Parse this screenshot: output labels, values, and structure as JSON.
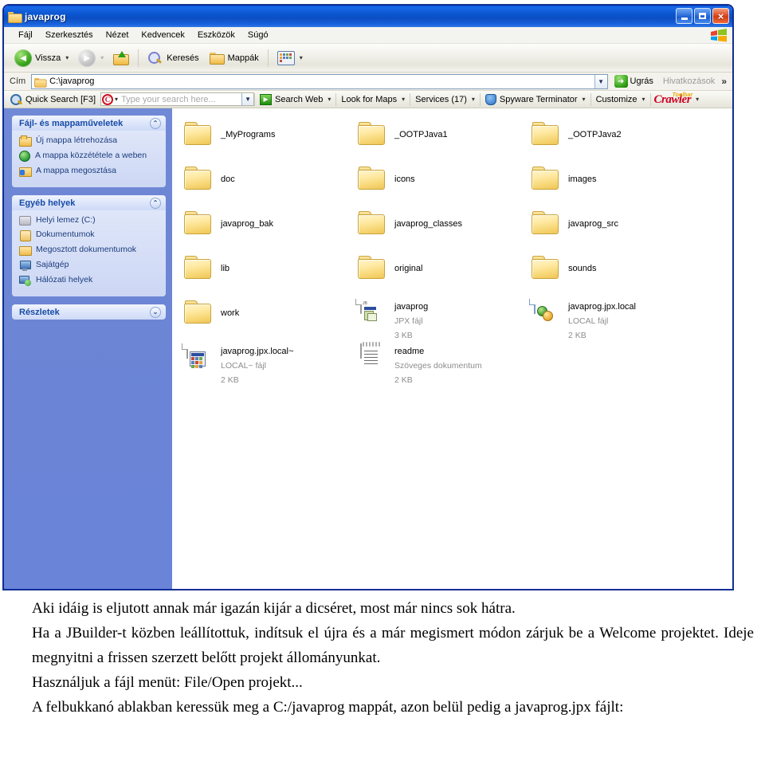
{
  "window": {
    "title": "javaprog",
    "buttons": {
      "minimize": "minimize-button",
      "maximize": "maximize-button",
      "close": "×"
    }
  },
  "menubar": {
    "items": [
      {
        "label": "Fájl",
        "accel": "F"
      },
      {
        "label": "Szerkesztés",
        "accel": "z"
      },
      {
        "label": "Nézet",
        "accel": "N"
      },
      {
        "label": "Kedvencek",
        "accel": "v"
      },
      {
        "label": "Eszközök",
        "accel": "E"
      },
      {
        "label": "Súgó",
        "accel": "S"
      }
    ]
  },
  "toolbar": {
    "back_label": "Vissza",
    "forward_label": "",
    "up_label": "",
    "search_label": "Keresés",
    "folders_label": "Mappák",
    "views_label": ""
  },
  "addressbar": {
    "label": "Cím",
    "value": "C:\\javaprog",
    "go_label": "Ugrás",
    "links_label": "Hivatkozások",
    "more_chevron": "»"
  },
  "crawlerbar": {
    "quick_search_label": "Quick Search [F3]",
    "search_placeholder": "Type your search here...",
    "search_value": "",
    "search_web_label": "Search Web",
    "look_for_maps_label": "Look for Maps",
    "services_label": "Services (17)",
    "spyware_label": "Spyware Terminator",
    "customize_label": "Customize",
    "brand_label": "Crawler",
    "brand_sup": "Toolbar",
    "caret": "▾"
  },
  "sidebar": {
    "panels": [
      {
        "title": "Fájl- és mappaműveletek",
        "chevron": "⌃",
        "collapsed": false,
        "items": [
          {
            "label": "Új mappa létrehozása",
            "icon": "new-folder-icon"
          },
          {
            "label": "A mappa közzététele a weben",
            "icon": "publish-web-icon"
          },
          {
            "label": "A mappa megosztása",
            "icon": "share-folder-icon"
          }
        ]
      },
      {
        "title": "Egyéb helyek",
        "chevron": "⌃",
        "collapsed": false,
        "items": [
          {
            "label": "Helyi lemez (C:)",
            "icon": "local-disk-icon"
          },
          {
            "label": "Dokumentumok",
            "icon": "documents-icon"
          },
          {
            "label": "Megosztott dokumentumok",
            "icon": "shared-documents-icon"
          },
          {
            "label": "Sajátgép",
            "icon": "my-computer-icon"
          },
          {
            "label": "Hálózati helyek",
            "icon": "network-places-icon"
          }
        ]
      },
      {
        "title": "Részletek",
        "chevron": "⌄",
        "collapsed": true,
        "items": []
      }
    ]
  },
  "files": [
    {
      "name": "_MyPrograms",
      "type": "folder",
      "subtype": "",
      "size": ""
    },
    {
      "name": "_OOTPJava1",
      "type": "folder",
      "subtype": "",
      "size": ""
    },
    {
      "name": "_OOTPJava2",
      "type": "folder",
      "subtype": "",
      "size": ""
    },
    {
      "name": "doc",
      "type": "folder",
      "subtype": "",
      "size": ""
    },
    {
      "name": "icons",
      "type": "folder",
      "subtype": "",
      "size": ""
    },
    {
      "name": "images",
      "type": "folder",
      "subtype": "",
      "size": ""
    },
    {
      "name": "javaprog_bak",
      "type": "folder",
      "subtype": "",
      "size": ""
    },
    {
      "name": "javaprog_classes",
      "type": "folder",
      "subtype": "",
      "size": ""
    },
    {
      "name": "javaprog_src",
      "type": "folder",
      "subtype": "",
      "size": ""
    },
    {
      "name": "lib",
      "type": "folder",
      "subtype": "",
      "size": ""
    },
    {
      "name": "original",
      "type": "folder",
      "subtype": "",
      "size": ""
    },
    {
      "name": "sounds",
      "type": "folder",
      "subtype": "",
      "size": ""
    },
    {
      "name": "work",
      "type": "folder",
      "subtype": "",
      "size": ""
    },
    {
      "name": "javaprog",
      "type": "jpx",
      "subtype": "JPX fájl",
      "size": "3 KB"
    },
    {
      "name": "javaprog.jpx.local",
      "type": "local",
      "subtype": "LOCAL fájl",
      "size": "2 KB"
    },
    {
      "name": "javaprog.jpx.local~",
      "type": "localtilde",
      "subtype": "LOCAL~ fájl",
      "size": "2 KB"
    },
    {
      "name": "readme",
      "type": "text",
      "subtype": "Szöveges dokumentum",
      "size": "2 KB"
    }
  ],
  "bodytext": {
    "line1": "Aki idáig is eljutott annak már igazán kijár a dicséret, most már nincs sok hátra.",
    "line2": "Ha a JBuilder-t közben leállítottuk, indítsuk el újra és a már megismert módon zárjuk be a Welcome projektet. Ideje megnyitni a frissen szerzett belőtt projekt állományunkat.",
    "line3": "Használjuk a fájl menüt: File/Open projekt...",
    "line4": "A felbukkanó ablakban keressük meg a C:/javaprog mappát, azon belül pedig a javaprog.jpx fájlt:"
  },
  "colors": {
    "titlebar_blue": "#0a55cf",
    "sidebar_blue": "#6c85d4",
    "panel_header": "#dfe7fb",
    "panel_title_text": "#174ba6",
    "folder_yellow": "#f7d878",
    "crawler_red": "#cc0022",
    "go_green": "#2f9e13"
  }
}
